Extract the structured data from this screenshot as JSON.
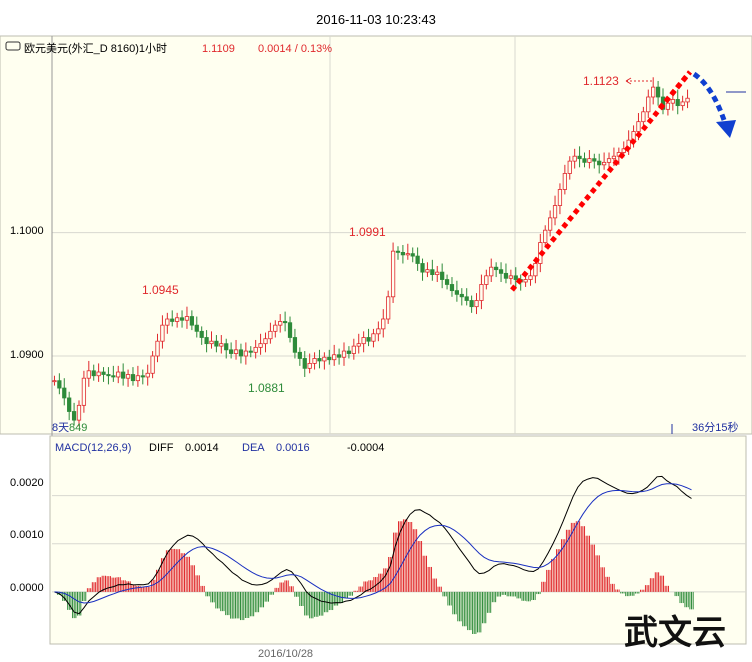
{
  "header": {
    "timestamp": "2016-11-03 10:23:43",
    "symbol_icon": "link-icon",
    "instrument": "欧元美元(外汇_D 8160)1小时",
    "last_price": "1.1109",
    "change": "0.0014 / 0.13%"
  },
  "price_panel": {
    "y_ticks": [
      "1.1000",
      "1.0900"
    ],
    "left_label": "8天",
    "left_value": "849",
    "countdown": "36分15秒",
    "annotations": [
      {
        "text": "1.0945",
        "color": "#e0282c"
      },
      {
        "text": "1.0881",
        "color": "#2e8b3a"
      },
      {
        "text": "1.0991",
        "color": "#e0282c"
      },
      {
        "text": "1.1123",
        "color": "#e0282c"
      }
    ]
  },
  "macd_panel": {
    "label": "MACD(12,26,9)",
    "diff_label": "DIFF",
    "diff_value": "0.0014",
    "dea_label": "DEA",
    "dea_value": "0.0016",
    "macd_value": "-0.0004",
    "y_ticks": [
      "0.0020",
      "0.0010",
      "0.0000"
    ]
  },
  "x_axis": {
    "date_label": "2016/10/28"
  },
  "watermark": {
    "text": "武文云"
  },
  "colors": {
    "bg_panel": "#fffff0",
    "up": "#e0282c",
    "down": "#2e8b3a",
    "blue_label": "#2030a0",
    "grid": "#d8d8d0",
    "trend_red": "#ff0000",
    "trend_blue": "#1040d0"
  },
  "chart_data": {
    "type": "candlestick",
    "price_ylim": [
      1.084,
      1.114
    ],
    "candles_close_series": [
      1.088,
      1.0874,
      1.0866,
      1.0855,
      1.0848,
      1.086,
      1.0882,
      1.0888,
      1.0884,
      1.0887,
      1.0885,
      1.0884,
      1.0883,
      1.0887,
      1.0882,
      1.0885,
      1.088,
      1.0884,
      1.0883,
      1.0886,
      1.09,
      1.0912,
      1.0925,
      1.093,
      1.0928,
      1.0931,
      1.0929,
      1.0932,
      1.0925,
      1.092,
      1.0915,
      1.091,
      1.0912,
      1.0908,
      1.091,
      1.0905,
      1.0902,
      1.0905,
      1.09,
      1.0904,
      1.0903,
      1.0907,
      1.091,
      1.0914,
      1.092,
      1.0925,
      1.0928,
      1.0927,
      1.0915,
      1.0903,
      1.0898,
      1.089,
      1.0894,
      1.0898,
      1.0896,
      1.0899,
      1.0897,
      1.0901,
      1.0899,
      1.0904,
      1.0902,
      1.0908,
      1.091,
      1.0915,
      1.0912,
      1.0918,
      1.0922,
      1.093,
      1.0948,
      1.0985,
      1.0984,
      1.0982,
      1.0983,
      1.0981,
      1.0975,
      1.0968,
      1.097,
      1.0966,
      1.0968,
      1.0962,
      1.0958,
      1.0953,
      1.095,
      1.0948,
      1.0945,
      1.094,
      1.0945,
      1.0958,
      1.0965,
      1.0972,
      1.097,
      1.0967,
      1.0963,
      1.0965,
      1.0962,
      1.096,
      1.0962,
      1.0965,
      1.0975,
      1.0992,
      1.1002,
      1.1012,
      1.1022,
      1.1035,
      1.1048,
      1.1058,
      1.1062,
      1.106,
      1.1057,
      1.106,
      1.1058,
      1.1055,
      1.1057,
      1.106,
      1.1062,
      1.1065,
      1.1068,
      1.1075,
      1.1082,
      1.109,
      1.1098,
      1.111,
      1.1118,
      1.111,
      1.11,
      1.1105,
      1.1108,
      1.1103,
      1.1106,
      1.1109
    ],
    "macd": {
      "diff_start": 0.0,
      "dea_start": 0.0,
      "diff_peaks": [
        0.0011,
        0.0004,
        0.0021,
        0.0007,
        0.0024,
        0.0022
      ],
      "current_diff": 0.0014,
      "current_dea": 0.0016,
      "current_macd": -0.0004,
      "ylim": [
        -0.001,
        0.0027
      ]
    }
  }
}
